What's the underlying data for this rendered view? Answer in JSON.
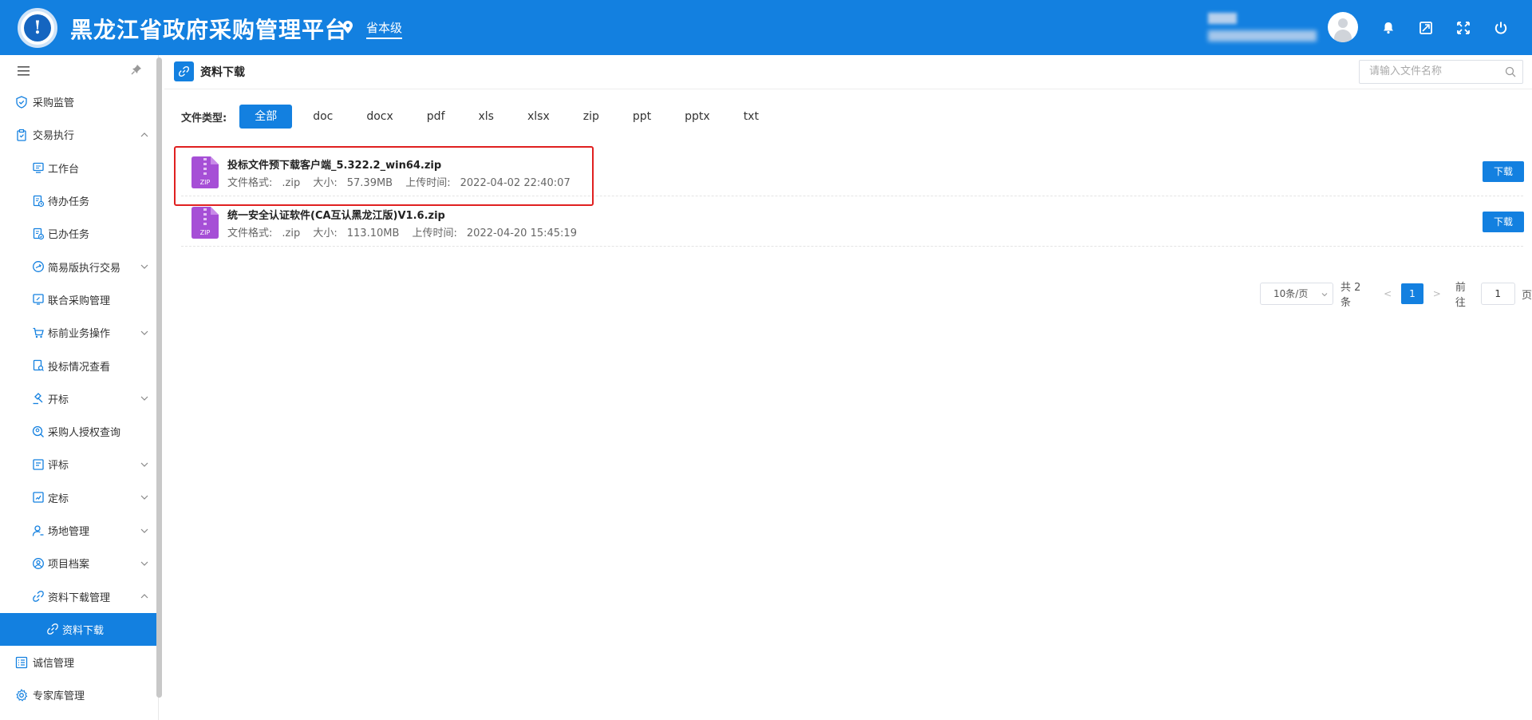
{
  "header": {
    "logo_char": "!",
    "title": "黑龙江省政府采购管理平台",
    "level": "省本级"
  },
  "sidebar": {
    "items": [
      {
        "label": "采购监管"
      },
      {
        "label": "交易执行"
      },
      {
        "label": "工作台"
      },
      {
        "label": "待办任务"
      },
      {
        "label": "已办任务"
      },
      {
        "label": "简易版执行交易"
      },
      {
        "label": "联合采购管理"
      },
      {
        "label": "标前业务操作"
      },
      {
        "label": "投标情况查看"
      },
      {
        "label": "开标"
      },
      {
        "label": "采购人授权查询"
      },
      {
        "label": "评标"
      },
      {
        "label": "定标"
      },
      {
        "label": "场地管理"
      },
      {
        "label": "项目档案"
      },
      {
        "label": "资料下载管理"
      },
      {
        "label": "资料下载"
      },
      {
        "label": "诚信管理"
      },
      {
        "label": "专家库管理"
      }
    ]
  },
  "page": {
    "title": "资料下载",
    "search_placeholder": "请输入文件名称"
  },
  "filter": {
    "label": "文件类型:",
    "options": [
      "全部",
      "doc",
      "docx",
      "pdf",
      "xls",
      "xlsx",
      "zip",
      "ppt",
      "pptx",
      "txt"
    ],
    "selected": "全部"
  },
  "files": [
    {
      "icon_text": "ZIP",
      "name": "投标文件预下载客户端_5.322.2_win64.zip",
      "format_label": "文件格式:",
      "format": ".zip",
      "size_label": "大小:",
      "size": "57.39MB",
      "time_label": "上传时间:",
      "time": "2022-04-02 22:40:07",
      "download_label": "下载"
    },
    {
      "icon_text": "ZIP",
      "name": "统一安全认证软件(CA互认黑龙江版)V1.6.zip",
      "format_label": "文件格式:",
      "format": ".zip",
      "size_label": "大小:",
      "size": "113.10MB",
      "time_label": "上传时间:",
      "time": "2022-04-20 15:45:19",
      "download_label": "下载"
    }
  ],
  "pagination": {
    "page_size": "10条/页",
    "total": "共 2 条",
    "prev": "<",
    "current": "1",
    "next": ">",
    "goto_label": "前往",
    "goto_value": "1",
    "page_suffix": "页"
  },
  "colors": {
    "brand": "#1380e0",
    "highlight": "#e02020",
    "zip_icon": "#a64fd6"
  }
}
